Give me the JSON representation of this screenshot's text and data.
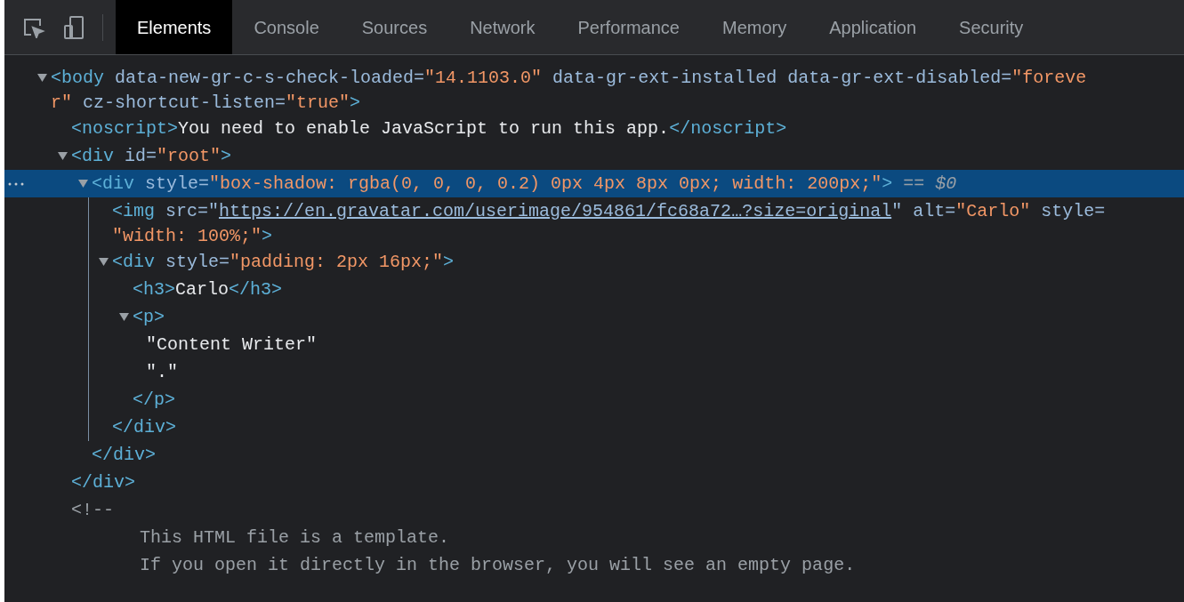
{
  "toolbar": {
    "tabs": [
      {
        "label": "Elements",
        "selected": true
      },
      {
        "label": "Console",
        "selected": false
      },
      {
        "label": "Sources",
        "selected": false
      },
      {
        "label": "Network",
        "selected": false
      },
      {
        "label": "Performance",
        "selected": false
      },
      {
        "label": "Memory",
        "selected": false
      },
      {
        "label": "Application",
        "selected": false
      },
      {
        "label": "Security",
        "selected": false
      }
    ]
  },
  "dom_tree": [
    {
      "kind": "element",
      "expanded": true,
      "selected": false,
      "lines": [
        [
          {
            "kind": "tag",
            "text": "<body"
          },
          {
            "kind": "attr",
            "text": " data-new-gr-c-s-check-loaded="
          },
          {
            "kind": "value",
            "text": "\"14.1103.0\""
          },
          {
            "kind": "attr",
            "text": " data-gr-ext-installed data-gr-ext-disabled="
          },
          {
            "kind": "value",
            "text": "\"foreve"
          }
        ],
        [
          {
            "kind": "value",
            "text": "r\""
          },
          {
            "kind": "attr",
            "text": " cz-shortcut-listen="
          },
          {
            "kind": "value",
            "text": "\"true\""
          },
          {
            "kind": "tag",
            "text": ">"
          }
        ]
      ],
      "children": [
        {
          "kind": "element",
          "selected": false,
          "lines": [
            [
              {
                "kind": "tag",
                "text": "<noscript>"
              },
              {
                "kind": "text",
                "text": "You need to enable JavaScript to run this app."
              },
              {
                "kind": "tag",
                "text": "</noscript>"
              }
            ]
          ]
        },
        {
          "kind": "element",
          "expanded": true,
          "selected": false,
          "lines": [
            [
              {
                "kind": "tag",
                "text": "<div"
              },
              {
                "kind": "attr",
                "text": " id="
              },
              {
                "kind": "value",
                "text": "\"root\""
              },
              {
                "kind": "tag",
                "text": ">"
              }
            ]
          ],
          "children": [
            {
              "kind": "element",
              "expanded": true,
              "selected": true,
              "suffix": "== $0",
              "lines": [
                [
                  {
                    "kind": "tag",
                    "text": "<div"
                  },
                  {
                    "kind": "attr",
                    "text": " style="
                  },
                  {
                    "kind": "value",
                    "text": "\"box-shadow: rgba(0, 0, 0, 0.2) 0px 4px 8px 0px; width: 200px;\""
                  },
                  {
                    "kind": "tag",
                    "text": ">"
                  }
                ]
              ],
              "children": [
                {
                  "kind": "element",
                  "selected": false,
                  "lines": [
                    [
                      {
                        "kind": "tag",
                        "text": "<img"
                      },
                      {
                        "kind": "attr",
                        "text": " src=\""
                      },
                      {
                        "kind": "link",
                        "text": "https://en.gravatar.com/userimage/954861/fc68a72…?size=original"
                      },
                      {
                        "kind": "attr",
                        "text": "\" alt="
                      },
                      {
                        "kind": "value",
                        "text": "\"Carlo\""
                      },
                      {
                        "kind": "attr",
                        "text": " style="
                      }
                    ],
                    [
                      {
                        "kind": "value",
                        "text": "\"width: 100%;\""
                      },
                      {
                        "kind": "tag",
                        "text": ">"
                      }
                    ]
                  ]
                },
                {
                  "kind": "element",
                  "expanded": true,
                  "selected": false,
                  "lines": [
                    [
                      {
                        "kind": "tag",
                        "text": "<div"
                      },
                      {
                        "kind": "attr",
                        "text": " style="
                      },
                      {
                        "kind": "value",
                        "text": "\"padding: 2px 16px;\""
                      },
                      {
                        "kind": "tag",
                        "text": ">"
                      }
                    ]
                  ],
                  "children": [
                    {
                      "kind": "element",
                      "selected": false,
                      "lines": [
                        [
                          {
                            "kind": "tag",
                            "text": "<h3>"
                          },
                          {
                            "kind": "text",
                            "text": "Carlo"
                          },
                          {
                            "kind": "tag",
                            "text": "</h3>"
                          }
                        ]
                      ]
                    },
                    {
                      "kind": "element",
                      "expanded": true,
                      "selected": false,
                      "lines": [
                        [
                          {
                            "kind": "tag",
                            "text": "<p>"
                          }
                        ]
                      ],
                      "children": [
                        {
                          "kind": "text",
                          "lines": [
                            [
                              {
                                "kind": "text",
                                "text": "\"Content Writer\""
                              }
                            ]
                          ]
                        },
                        {
                          "kind": "text",
                          "lines": [
                            [
                              {
                                "kind": "text",
                                "text": "\".\""
                              }
                            ]
                          ]
                        }
                      ],
                      "close": "</p>"
                    }
                  ],
                  "close": "</div>"
                }
              ],
              "close": "</div>"
            }
          ],
          "close": "</div>"
        },
        {
          "kind": "comment",
          "lines": [
            [
              {
                "kind": "comment",
                "text": "<!--"
              }
            ],
            [
              {
                "kind": "comment",
                "text": "This HTML file is a template."
              }
            ],
            [
              {
                "kind": "comment",
                "text": "If you open it directly in the browser, you will see an empty page."
              }
            ]
          ]
        }
      ]
    }
  ]
}
